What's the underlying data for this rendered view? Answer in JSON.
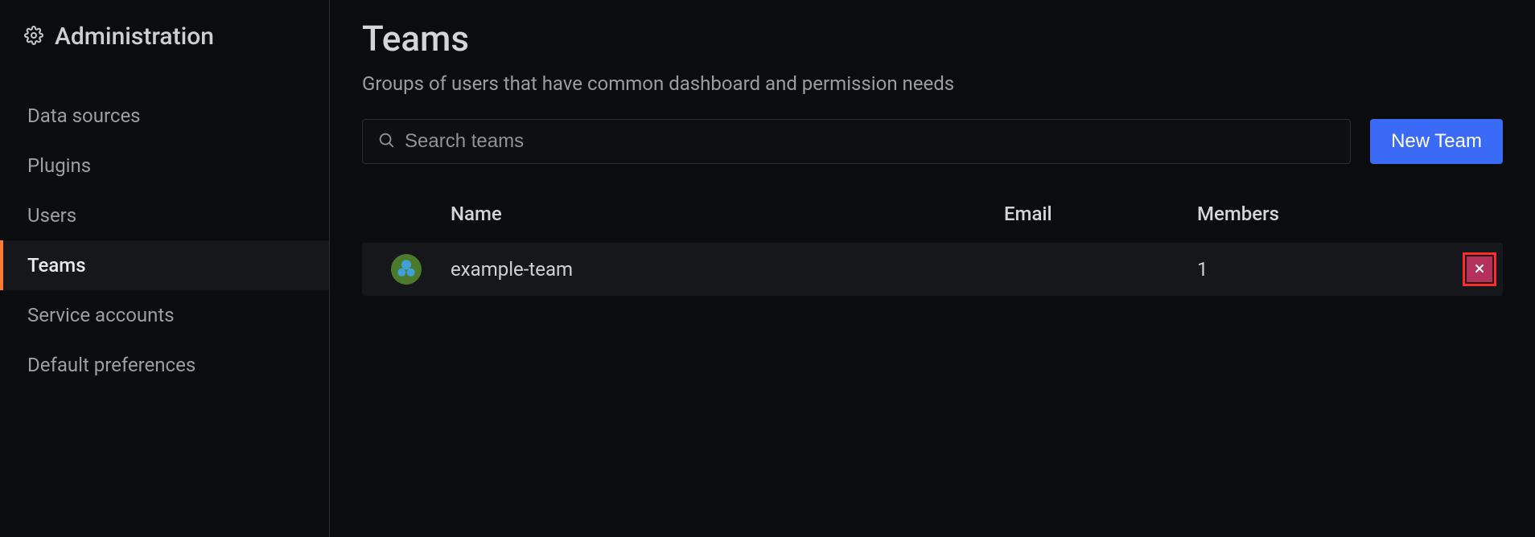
{
  "sidebar": {
    "title": "Administration",
    "items": [
      {
        "label": "Data sources",
        "active": false
      },
      {
        "label": "Plugins",
        "active": false
      },
      {
        "label": "Users",
        "active": false
      },
      {
        "label": "Teams",
        "active": true
      },
      {
        "label": "Service accounts",
        "active": false
      },
      {
        "label": "Default preferences",
        "active": false
      }
    ]
  },
  "page": {
    "title": "Teams",
    "subtitle": "Groups of users that have common dashboard and permission needs"
  },
  "search": {
    "placeholder": "Search teams"
  },
  "buttons": {
    "new_team": "New Team"
  },
  "table": {
    "headers": {
      "name": "Name",
      "email": "Email",
      "members": "Members"
    },
    "rows": [
      {
        "name": "example-team",
        "email": "",
        "members": "1"
      }
    ]
  },
  "colors": {
    "accent": "#3a6af6",
    "active_indicator": "#ff7b33",
    "danger": "#b5305a"
  }
}
